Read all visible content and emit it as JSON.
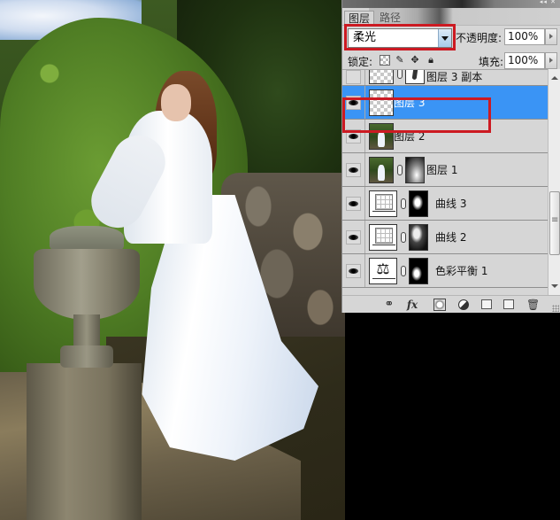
{
  "photo": {
    "description": "Woman in white wedding dress leaning on a stone urn in a garden"
  },
  "panel": {
    "tabs": [
      {
        "label": "图层",
        "active": true
      },
      {
        "label": "路径",
        "active": false
      }
    ],
    "blend_mode": "柔光",
    "opacity_label": "不透明度:",
    "opacity_value": "100%",
    "lock_label": "锁定:",
    "fill_label": "填充:",
    "fill_value": "100%",
    "lock_icons": [
      "lock-transparent-icon",
      "lock-paint-icon",
      "lock-move-icon",
      "lock-all-icon"
    ],
    "layers": [
      {
        "name": "图层 3 副本",
        "visible": false,
        "selected": false,
        "thumb": "transparent",
        "mask": "white",
        "linked": true
      },
      {
        "name": "图层 3",
        "visible": true,
        "selected": true,
        "thumb": "transparent",
        "mask": null,
        "linked": false
      },
      {
        "name": "图层 2",
        "visible": true,
        "selected": false,
        "thumb": "photo",
        "mask": null,
        "linked": false
      },
      {
        "name": "图层 1",
        "visible": true,
        "selected": false,
        "thumb": "photo",
        "mask": "gradient",
        "linked": true
      },
      {
        "name": "曲线 3",
        "visible": true,
        "selected": false,
        "thumb": "curves",
        "mask": "dark",
        "linked": true
      },
      {
        "name": "曲线 2",
        "visible": true,
        "selected": false,
        "thumb": "curves",
        "mask": "dark",
        "linked": true
      },
      {
        "name": "色彩平衡 1",
        "visible": true,
        "selected": false,
        "thumb": "color-balance",
        "mask": "dark",
        "linked": true
      }
    ],
    "bottom_buttons": [
      "link-layers",
      "add-layer-style",
      "add-mask",
      "new-adjustment-layer",
      "new-group",
      "new-layer",
      "delete-layer"
    ],
    "fx_label": "fx"
  },
  "colors": {
    "selection": "#3a94f5",
    "highlight_box": "#cc1a22",
    "panel_bg": "#d6d6d6"
  }
}
